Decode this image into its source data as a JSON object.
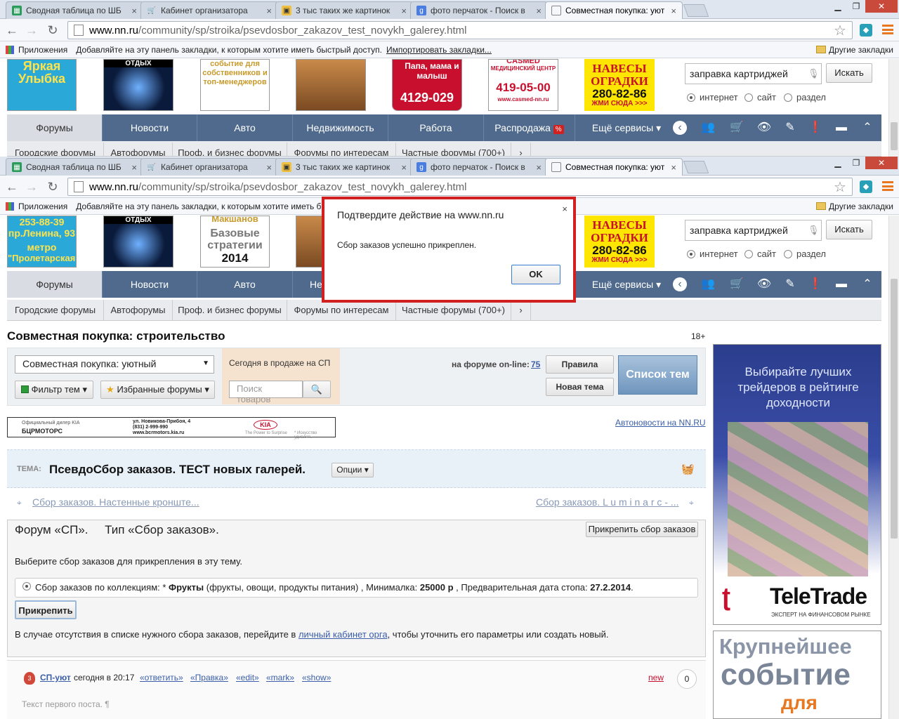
{
  "browser": {
    "tabs": [
      {
        "title": "Сводная таблица по ШБ",
        "icon": "sheet"
      },
      {
        "title": "Кабинет организатора",
        "icon": "cart"
      },
      {
        "title": "3 тыс таких же картинок",
        "icon": "image"
      },
      {
        "title": "фото перчаток - Поиск в",
        "icon": "google"
      },
      {
        "title": "Совместная покупка: уют",
        "icon": "page"
      }
    ],
    "url_host": "www.nn.ru",
    "url_path": "/community/sp/stroika/psevdosbor_zakazov_test_novykh_galerey.html",
    "bookmarks": {
      "apps": "Приложения",
      "hint": "Добавляйте на эту панель закладки, к которым хотите иметь быстрый доступ.",
      "hint_short": "Добавляйте на эту панель закладки, к которым хотите иметь б",
      "import": "Импортировать закладки...",
      "other": "Другие закладки"
    }
  },
  "ads_top": {
    "a1": "Яркая Улыбка",
    "a2": "ОТДЫХ",
    "a3": "событие для собственников и топ-менеджеров",
    "a5a": "Папа, мама и малыш",
    "a5b": "4129-029",
    "a6a": "CASMED",
    "a6b": "МЕДИЦИНСКИЙ ЦЕНТР",
    "a6c": "419-05-00",
    "a6d": "www.casmed-nn.ru",
    "a7a": "НАВЕСЫ",
    "a7b": "ОГРАДКИ",
    "a7c": "280-82-86",
    "a7d": "ЖМИ СЮДА >>>",
    "b1a": "253-88-39",
    "b1b": "пр.Ленина, 93",
    "b1c": "метро",
    "b1d": "\"Пролетарская\"",
    "b3a": "Макшанов",
    "b3b": "Базовые стратегии",
    "b3c": "2014"
  },
  "search": {
    "value": "заправка картриджей",
    "button": "Искать",
    "options": [
      "интернет",
      "сайт",
      "раздел"
    ]
  },
  "nav": {
    "items": [
      "Форумы",
      "Новости",
      "Авто",
      "Недвижимость",
      "Работа",
      "Распродажа",
      "Ещё сервисы"
    ],
    "items_bottom": [
      "Форумы",
      "Новости",
      "Авто",
      "Не",
      "Ещё сервисы"
    ],
    "sale_badge": "%",
    "sub": [
      "Городские форумы",
      "Автофорумы",
      "Проф. и бизнес форумы",
      "Форумы по интересам",
      "Частные форумы (700+)"
    ]
  },
  "dialog": {
    "title": "Подтвердите действие на www.nn.ru",
    "message": "Сбор заказов успешно прикреплен.",
    "ok": "OK",
    "close": "×"
  },
  "page": {
    "title": "Совместная покупка: строительство",
    "age": "18+",
    "forum_select": "Совместная покупка: уютный",
    "filter_btn": "Фильтр тем",
    "fav_btn": "Избранные форумы",
    "sale_label": "Сегодня в продаже на СП",
    "search_placeholder": "Поиск товаров",
    "online_label": "на форуме on-line:",
    "online_count": "75",
    "rules": "Правила",
    "new_topic": "Новая тема",
    "topics_list": "Список тем",
    "autonews": "Автоновости на NN.RU"
  },
  "kia_ad": {
    "dealer": "Официальный дилер KIA",
    "brand": "БЦРМОТОРС",
    "addr1": "ул. Новикова-Прибоя, 4",
    "addr2": "(831) 2-999-990",
    "addr3": "www.bcrmotors.kia.ru",
    "logo": "KIA",
    "slogan": "The Power to Surprise",
    "art": "* Искусство удивлять"
  },
  "topic": {
    "label": "ТЕМА:",
    "title": "ПсевдоСбор заказов. ТЕСТ новых галерей.",
    "options": "Опции",
    "prev": "Сбор заказов. Настенные кронште...",
    "next": "Сбор заказов. L u m i n a r c - ..."
  },
  "panel": {
    "forum_type": "Форум «СП».     Тип «Сбор заказов».",
    "attach_btn": "Прикрепить сбор заказов",
    "instruction": "Выберите сбор заказов для прикрепления в эту тему.",
    "option_prefix": "Сбор заказов по коллекциям: * ",
    "option_bold": "Фрукты",
    "option_mid": " (фрукты, овощи, продукты питания) , Минималка: ",
    "option_min": "25000 р",
    "option_after": " , Предварительная дата стопа: ",
    "option_date": "27.2.2014",
    "option_end": ".",
    "attach": "Прикрепить",
    "note_before": "В случае отсутствия в списке нужного сбора заказов, перейдите в ",
    "note_link": "личный кабинет орга",
    "note_after": ", чтобы уточнить его параметры или создать новый."
  },
  "post": {
    "author": "СП-уют",
    "time": "сегодня в 20:17",
    "actions": [
      "«ответить»",
      "«Правка»",
      "«edit»",
      "«mark»",
      "«show»"
    ],
    "new": "new",
    "count": "0",
    "text": "Текст первого поста. ¶"
  },
  "side_ads": {
    "forex_text": "Выбирайте лучших трейдеров в рейтинге доходности",
    "brand": "TeleTrade",
    "brand_sub": "ЭКСПЕРТ НА ФИНАНСОВОМ РЫНКЕ",
    "event1": "Крупнейшее",
    "event2": "событие",
    "event3": "для"
  },
  "colors": {
    "nav": "#4f6a8c",
    "dialog_border": "#d21f1f",
    "link": "#3a5ea8",
    "accent": "#e87722"
  }
}
